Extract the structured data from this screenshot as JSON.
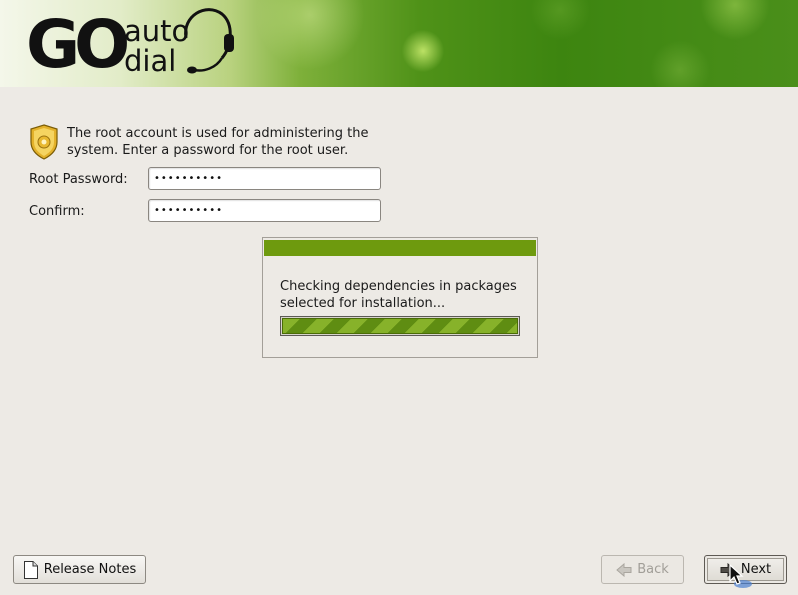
{
  "header": {
    "logo": {
      "go": "GO",
      "auto": "auto",
      "dial": "dial"
    }
  },
  "root_password": {
    "info_icon": "shield-badge-icon",
    "description": "The root account is used for administering the system.  Enter a password for the root user.",
    "password_label": "Root Password:",
    "password_value": "••••••••••",
    "confirm_label": "Confirm:",
    "confirm_value": "••••••••••"
  },
  "progress_dialog": {
    "message": "Checking dependencies in packages selected for installation...",
    "progress_fraction": 0.99,
    "accent_color": "#6e9a0e"
  },
  "footer": {
    "release_notes": {
      "label": "Release Notes",
      "icon": "document-icon"
    },
    "back": {
      "label": "Back",
      "icon": "back-arrow-icon",
      "enabled": false
    },
    "next": {
      "label": "Next",
      "icon": "next-arrow-icon",
      "enabled": true
    }
  },
  "colors": {
    "background": "#edeae5",
    "banner_green": "#4f9218"
  }
}
